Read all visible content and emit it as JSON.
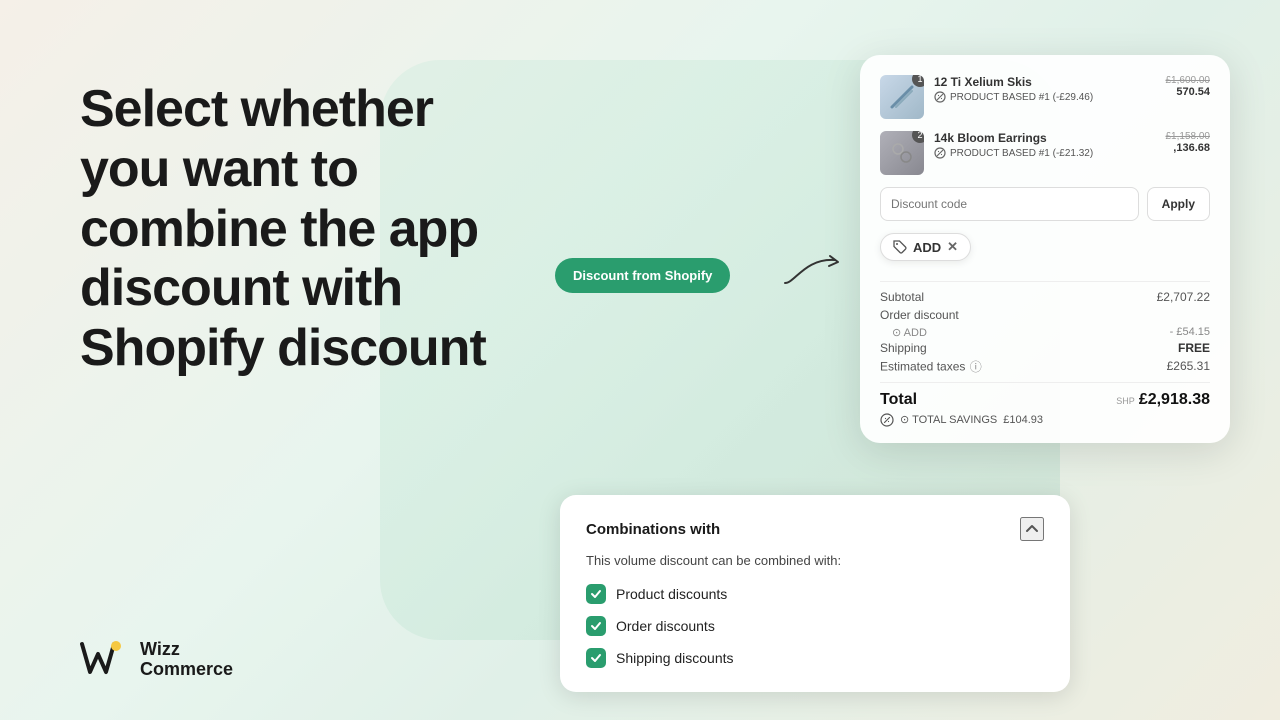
{
  "background": {
    "gradient_desc": "light warm-green gradient"
  },
  "heading": {
    "line1": "Select whether",
    "line2": "you want to",
    "line3": "combine the app",
    "line4": "discount with",
    "line5": "Shopify discount"
  },
  "logo": {
    "name_line1": "Wizz",
    "name_line2": "Commerce"
  },
  "shopify_badge": {
    "label": "Discount from Shopify"
  },
  "checkout_card": {
    "products": [
      {
        "name": "12 Ti Xelium Skis",
        "price_original": "£1,600.00",
        "price_current": "570.54",
        "discount_label": "PRODUCT BASED #1 (-£29.46)",
        "badge": "1"
      },
      {
        "name": "14k Bloom Earrings",
        "price_original": "£1,158.00",
        "price_current": ",136.68",
        "discount_label": "PRODUCT BASED #1 (-£21.32)",
        "badge": "2"
      }
    ],
    "discount_code_placeholder": "Discount code",
    "apply_label": "Apply",
    "add_label": "ADD",
    "summary": {
      "subtotal_label": "Subtotal",
      "subtotal_value": "£2,707.22",
      "order_discount_label": "Order discount",
      "add_sub_label": "⊙ ADD",
      "add_sub_value": "- £54.15",
      "shipping_label": "Shipping",
      "shipping_value": "FREE",
      "taxes_label": "Estimated taxes",
      "taxes_info": "ⓘ",
      "taxes_value": "£265.31",
      "total_label": "Total",
      "ship_prefix": "SHP",
      "total_value": "£2,918.38",
      "savings_label": "⊙ TOTAL SAVINGS",
      "savings_value": "£104.93"
    }
  },
  "combinations_card": {
    "title": "Combinations with",
    "description": "This volume discount can be combined with:",
    "options": [
      {
        "label": "Product discounts",
        "checked": true
      },
      {
        "label": "Order discounts",
        "checked": true
      },
      {
        "label": "Shipping discounts",
        "checked": true
      }
    ]
  }
}
